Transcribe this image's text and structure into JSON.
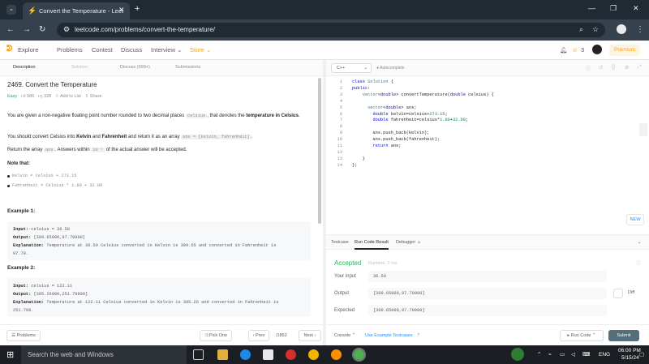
{
  "browser": {
    "tab_title": "Convert the Temperature - Leet",
    "close": "✕",
    "new_tab": "+",
    "url": "leetcode.com/problems/convert-the-temperature/"
  },
  "nav": {
    "items": [
      "Explore",
      "Problems",
      "Contest",
      "Discuss",
      "Interview ⌄",
      "Store ⌄"
    ],
    "streak": "3",
    "premium": "Premium"
  },
  "left_tabs": [
    "Description",
    "Solution",
    "Discuss (999+)",
    "Submissions"
  ],
  "problem": {
    "title": "2469. Convert the Temperature",
    "difficulty": "Easy",
    "likes": "586",
    "dislikes": "328",
    "add_to_list": "Add to List",
    "share": "Share",
    "p1_a": "You are given a non-negative floating point number rounded to two decimal places",
    "p1_code": "celsius",
    "p1_b": ", that denotes the",
    "p1_bold": "temperature in Celsius",
    "p1_end": ".",
    "p2_a": "You should convert Celsius into",
    "p2_k": "Kelvin",
    "p2_and": "and",
    "p2_f": "Fahrenheit",
    "p2_b": "and return it as an array",
    "p2_code": "ans = [kelvin, fahrenheit]",
    "p2_end": ".",
    "p3_a": "Return the array",
    "p3_code": "ans",
    "p3_b": ". Answers within",
    "p3_code2": "10⁻⁵",
    "p3_c": "of the actual answer will be accepted.",
    "note": "Note that:",
    "bullet1": "Kelvin = Celsius + 273.15",
    "bullet2": "Fahrenheit = Celsius * 1.80 + 32.00"
  },
  "examples": [
    {
      "head": "Example 1:",
      "input_label": "Input:",
      "input": "celsius = 36.50",
      "output_label": "Output:",
      "output": "[309.65000,97.70000]",
      "expl_label": "Explanation:",
      "expl": "Temperature at 36.50 Celsius converted in Kelvin is 309.65 and converted in Fahrenheit is",
      "expl2": "97.70."
    },
    {
      "head": "Example 2:",
      "input_label": "Input:",
      "input": "celsius = 122.11",
      "output_label": "Output:",
      "output": "[395.26000,251.79800]",
      "expl_label": "Explanation:",
      "expl": "Temperature at 122.11 Celsius converted in Kelvin is 395.26 and converted in Fahrenheit is",
      "expl2": "251.798."
    }
  ],
  "left_bottom": {
    "problems": "Problems",
    "pick_one": "Pick One",
    "prev": "‹ Prev",
    "counter": "/1852",
    "next": "Next ›"
  },
  "editor": {
    "language": "C++",
    "autocomplete": "Autocomplete",
    "code_lines": [
      "class Solution {",
      "public:",
      "    vector<double> convertTemperature(double celsius) {",
      "",
      "      vector<double> ans;",
      "        double kelvin=celsius+273.15;",
      "        double fahrenheit=celsius*1.80+32.00;",
      "",
      "        ans.push_back(kelvin);",
      "        ans.push_back(fahrenheit);",
      "        return ans;",
      "",
      "    }",
      "};"
    ],
    "new_badge": "NEW"
  },
  "console": {
    "tabs": [
      "Testcase",
      "Run Code Result",
      "Debugger"
    ],
    "status": "Accepted",
    "runtime": "Runtime: 2 ms",
    "your_input_label": "Your input",
    "your_input": "36.50",
    "output_label": "Output",
    "output": "[309.65000,97.70000]",
    "diff": "Diff",
    "expected_label": "Expected",
    "expected": "[309.65000,97.70000]",
    "console_btn": "Console ⌃",
    "use_example": "Use Example Testcases",
    "run_code": "▸ Run Code ⌃",
    "submit": "Submit"
  },
  "taskbar": {
    "search": "Search the web and Windows",
    "lang": "ENG",
    "time": "06:00 PM",
    "date": "5/15/24"
  },
  "colors": {
    "accepted": "#2db55d",
    "easy": "#00af9b",
    "brand": "#ffa116",
    "submit": "#546e7a"
  }
}
